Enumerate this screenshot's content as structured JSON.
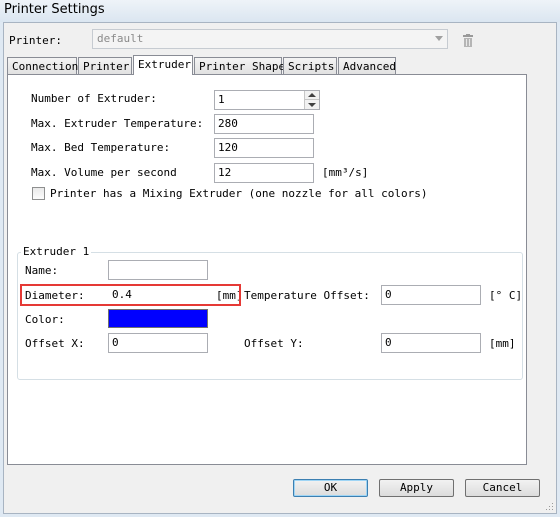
{
  "window": {
    "title": "Printer Settings"
  },
  "printer": {
    "label": "Printer:",
    "selected": "default"
  },
  "tabs": [
    {
      "label": "Connection"
    },
    {
      "label": "Printer"
    },
    {
      "label": "Extruder",
      "active": true
    },
    {
      "label": "Printer Shape"
    },
    {
      "label": "Scripts"
    },
    {
      "label": "Advanced"
    }
  ],
  "extruder": {
    "num_extruder_label": "Number of Extruder:",
    "num_extruder_value": "1",
    "max_extruder_temp_label": "Max. Extruder Temperature:",
    "max_extruder_temp_value": "280",
    "max_bed_temp_label": "Max. Bed Temperature:",
    "max_bed_temp_value": "120",
    "max_volume_label": "Max. Volume per second",
    "max_volume_value": "12",
    "max_volume_unit": "[mm³/s]",
    "mixing_label": "Printer has a Mixing Extruder (one nozzle for all colors)",
    "mixing_checked": false
  },
  "extruder1": {
    "group_title": "Extruder 1",
    "name_label": "Name:",
    "name_value": "",
    "diameter_label": "Diameter:",
    "diameter_value": "0.4",
    "diameter_unit": "[mm]",
    "temp_offset_label": "Temperature Offset:",
    "temp_offset_value": "0",
    "temp_offset_unit": "[° C]",
    "color_label": "Color:",
    "color_value": "#0000ff",
    "offset_x_label": "Offset X:",
    "offset_x_value": "0",
    "offset_y_label": "Offset Y:",
    "offset_y_value": "0",
    "offset_unit": "[mm]"
  },
  "buttons": {
    "ok": "OK",
    "apply": "Apply",
    "cancel": "Cancel"
  }
}
